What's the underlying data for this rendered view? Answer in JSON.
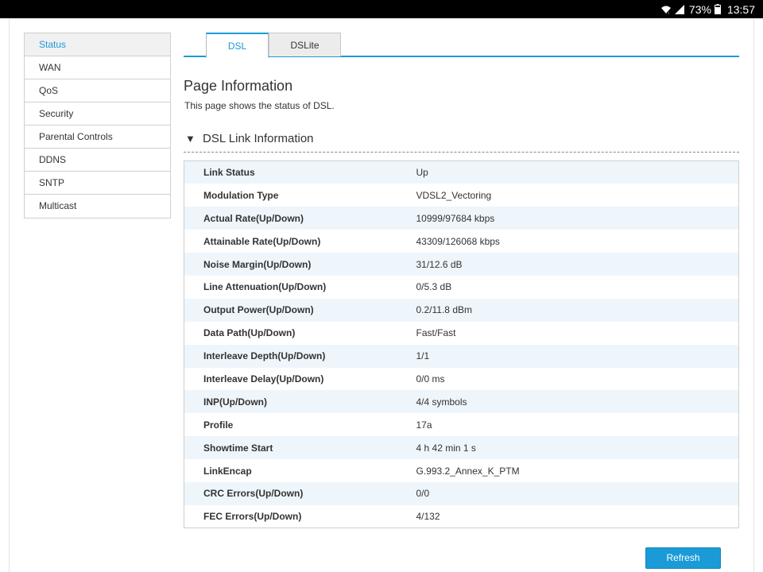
{
  "status_bar": {
    "battery_percent": "73%",
    "time": "13:57"
  },
  "sidebar": {
    "items": [
      {
        "label": "Status"
      },
      {
        "label": "WAN"
      },
      {
        "label": "QoS"
      },
      {
        "label": "Security"
      },
      {
        "label": "Parental Controls"
      },
      {
        "label": "DDNS"
      },
      {
        "label": "SNTP"
      },
      {
        "label": "Multicast"
      }
    ],
    "active_index": 0
  },
  "tabs": [
    {
      "label": "DSL",
      "active": true
    },
    {
      "label": "DSLite",
      "active": false
    }
  ],
  "page": {
    "title": "Page Information",
    "description": "This page shows the status of DSL."
  },
  "section": {
    "title": "DSL Link Information",
    "expanded": true
  },
  "rows": [
    {
      "key": "Link Status",
      "value": "Up"
    },
    {
      "key": "Modulation Type",
      "value": "VDSL2_Vectoring"
    },
    {
      "key": "Actual Rate(Up/Down)",
      "value": "10999/97684 kbps"
    },
    {
      "key": "Attainable Rate(Up/Down)",
      "value": "43309/126068 kbps"
    },
    {
      "key": "Noise Margin(Up/Down)",
      "value": "31/12.6 dB"
    },
    {
      "key": "Line Attenuation(Up/Down)",
      "value": "0/5.3 dB"
    },
    {
      "key": "Output Power(Up/Down)",
      "value": "0.2/11.8 dBm"
    },
    {
      "key": "Data Path(Up/Down)",
      "value": "Fast/Fast"
    },
    {
      "key": "Interleave Depth(Up/Down)",
      "value": "1/1"
    },
    {
      "key": "Interleave Delay(Up/Down)",
      "value": "0/0 ms"
    },
    {
      "key": "INP(Up/Down)",
      "value": "4/4 symbols"
    },
    {
      "key": "Profile",
      "value": "17a"
    },
    {
      "key": "Showtime Start",
      "value": "4 h 42 min 1 s"
    },
    {
      "key": "LinkEncap",
      "value": "G.993.2_Annex_K_PTM"
    },
    {
      "key": "CRC Errors(Up/Down)",
      "value": "0/0"
    },
    {
      "key": "FEC Errors(Up/Down)",
      "value": "4/132"
    }
  ],
  "buttons": {
    "refresh_label": "Refresh"
  },
  "colors": {
    "accent": "#1a9bd7",
    "row_stripe": "#eef6fc",
    "status_bar": "#000000"
  },
  "icons": [
    "wifi-icon",
    "signal-icon",
    "battery-icon",
    "triangle-down-icon"
  ]
}
